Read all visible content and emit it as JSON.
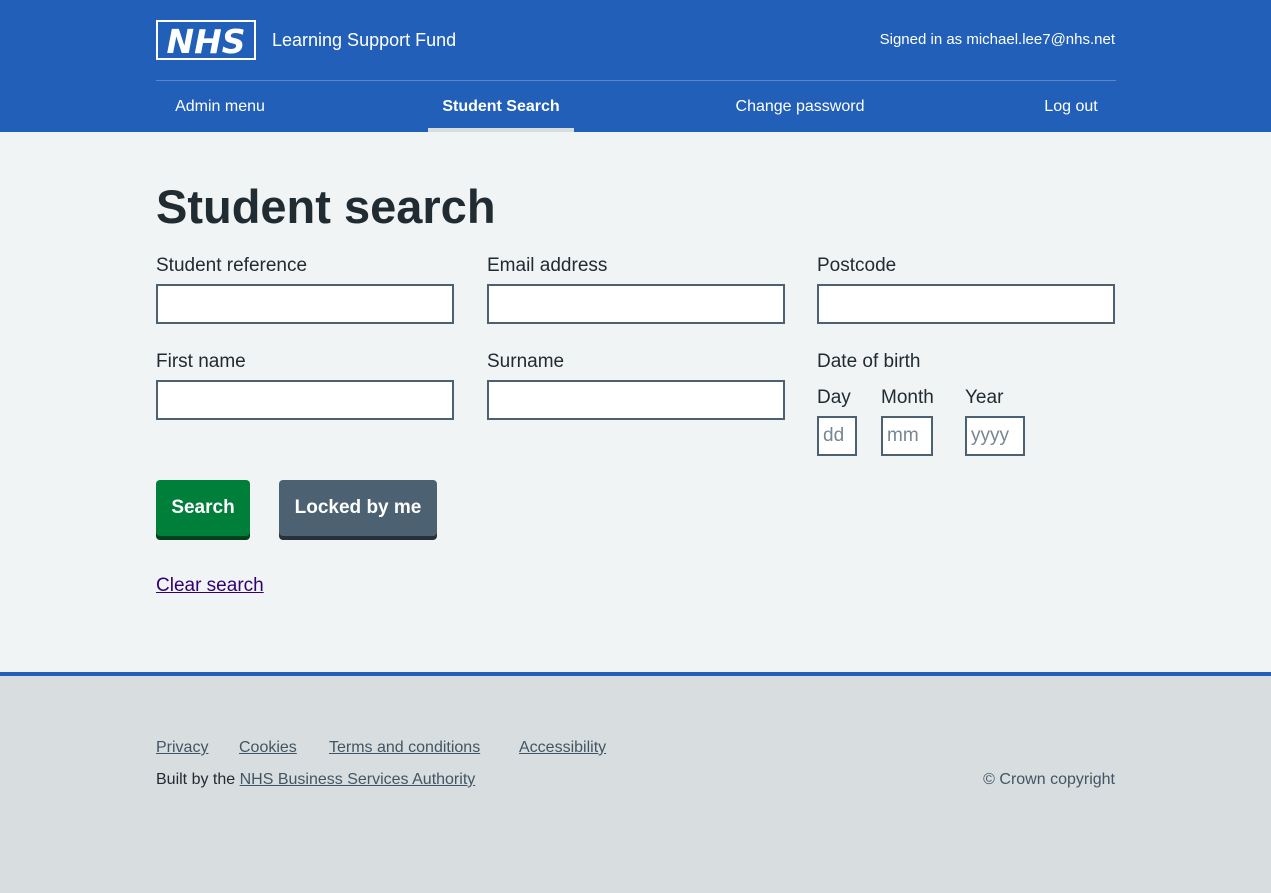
{
  "header": {
    "logo_text": "NHS",
    "service_name": "Learning Support Fund",
    "signed_in": "Signed in as michael.lee7@nhs.net",
    "nav": [
      {
        "label": "Admin menu"
      },
      {
        "label": "Student Search"
      },
      {
        "label": "Change password"
      },
      {
        "label": "Log out"
      }
    ],
    "active_nav": "Student Search"
  },
  "main": {
    "title": "Student search",
    "fields": {
      "student_reference": {
        "label": "Student reference",
        "value": ""
      },
      "email": {
        "label": "Email address",
        "value": ""
      },
      "postcode": {
        "label": "Postcode",
        "value": ""
      },
      "first_name": {
        "label": "First name",
        "value": ""
      },
      "surname": {
        "label": "Surname",
        "value": ""
      }
    },
    "dob": {
      "label": "Date of birth",
      "day_label": "Day",
      "day_placeholder": "dd",
      "month_label": "Month",
      "month_placeholder": "mm",
      "year_label": "Year",
      "year_placeholder": "yyyy"
    },
    "search_button": "Search",
    "locked_button": "Locked by me",
    "clear_link": "Clear search"
  },
  "footer": {
    "links": [
      "Privacy",
      "Cookies",
      "Terms and conditions",
      "Accessibility"
    ],
    "built_by_prefix": "Built by the",
    "built_by_link": "NHS Business Services Authority",
    "copyright": "© Crown copyright"
  },
  "colors": {
    "brand_blue": "#215fb8",
    "search_green": "#007f3b",
    "secondary_grey": "#4c6272",
    "link_visited": "#330072"
  }
}
